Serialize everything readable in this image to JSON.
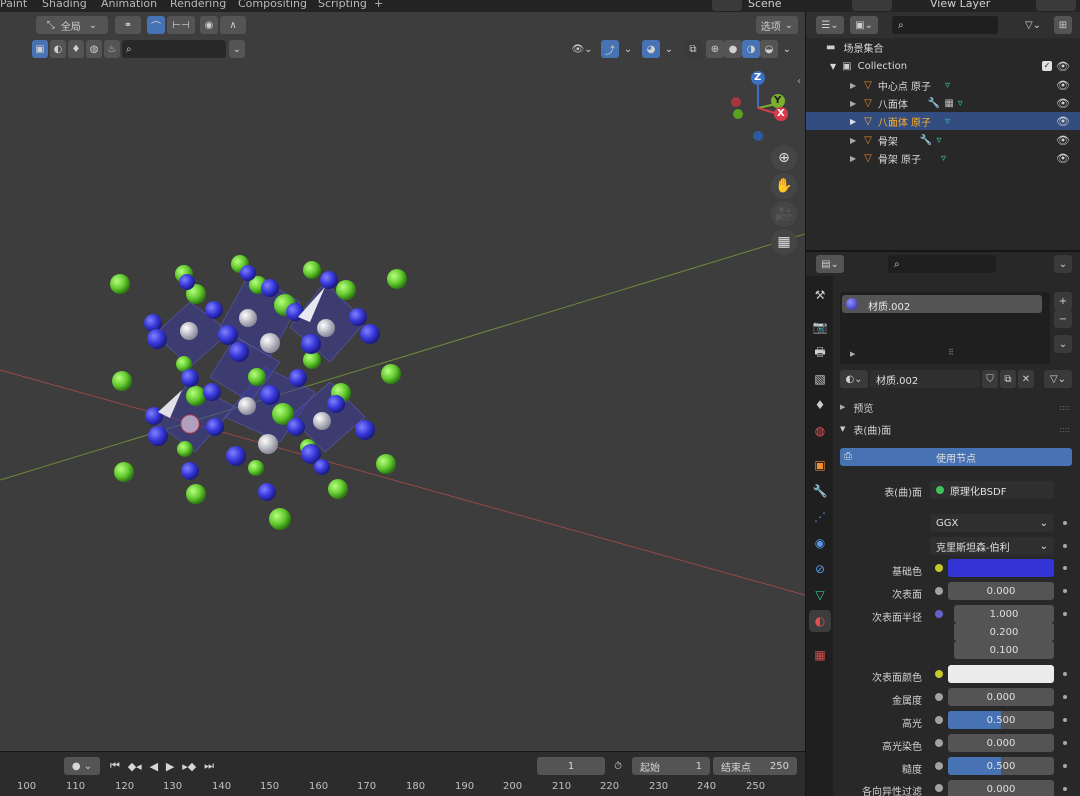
{
  "workspace_tabs": [
    "Paint",
    "Shading",
    "Animation",
    "Rendering",
    "Compositing",
    "Scripting",
    "+"
  ],
  "header_right": {
    "scene": "Scene",
    "view_layer": "View Layer"
  },
  "viewport": {
    "orientation": "全局",
    "options_label": "选项",
    "gizmo": {
      "z": "Z",
      "y": "Y",
      "x": "X"
    }
  },
  "timeline": {
    "current_frame": "1",
    "start_label": "起始",
    "start_value": "1",
    "end_label": "结束点",
    "end_value": "250",
    "ticks": [
      "100",
      "110",
      "120",
      "130",
      "140",
      "150",
      "160",
      "170",
      "180",
      "190",
      "200",
      "210",
      "220",
      "230",
      "240",
      "250"
    ]
  },
  "outliner": {
    "scene_collection": "场景集合",
    "collection": "Collection",
    "items": [
      {
        "label": "中心点 原子",
        "selected": false
      },
      {
        "label": "八面体",
        "selected": false
      },
      {
        "label": "八面体 原子",
        "selected": true
      },
      {
        "label": "骨架",
        "selected": false
      },
      {
        "label": "骨架 原子",
        "selected": false
      }
    ]
  },
  "properties": {
    "slot_name": "材质.002",
    "material_name": "材质.002",
    "preview_label": "预览",
    "surface_panel": "表(曲)面",
    "use_nodes": "使用节点",
    "surface_label": "表(曲)面",
    "surface_shader": "原理化BSDF",
    "distribution": "GGX",
    "subsurface_method": "克里斯坦森-伯利",
    "rows": [
      {
        "label": "基础色",
        "type": "color",
        "color": "#3434d6"
      },
      {
        "label": "次表面",
        "type": "number",
        "value": "0.000"
      },
      {
        "label": "次表面半径",
        "type": "vector",
        "values": [
          "1.000",
          "0.200",
          "0.100"
        ]
      },
      {
        "label": "次表面颜色",
        "type": "color",
        "color": "#ececec"
      },
      {
        "label": "金属度",
        "type": "number",
        "value": "0.000"
      },
      {
        "label": "高光",
        "type": "slider",
        "value": "0.500",
        "fraction": 0.5
      },
      {
        "label": "高光染色",
        "type": "number",
        "value": "0.000"
      },
      {
        "label": "糙度",
        "type": "slider",
        "value": "0.500",
        "fraction": 0.5
      },
      {
        "label": "各向异性过滤",
        "type": "number",
        "value": "0.000"
      }
    ]
  },
  "colors": {
    "accent": "#4772b3",
    "selection": "#334d80",
    "active_object": "#ffaf29",
    "atom_blue": "#3a3adc",
    "atom_green": "#6fd23a",
    "atom_white": "#c8c8d0"
  }
}
